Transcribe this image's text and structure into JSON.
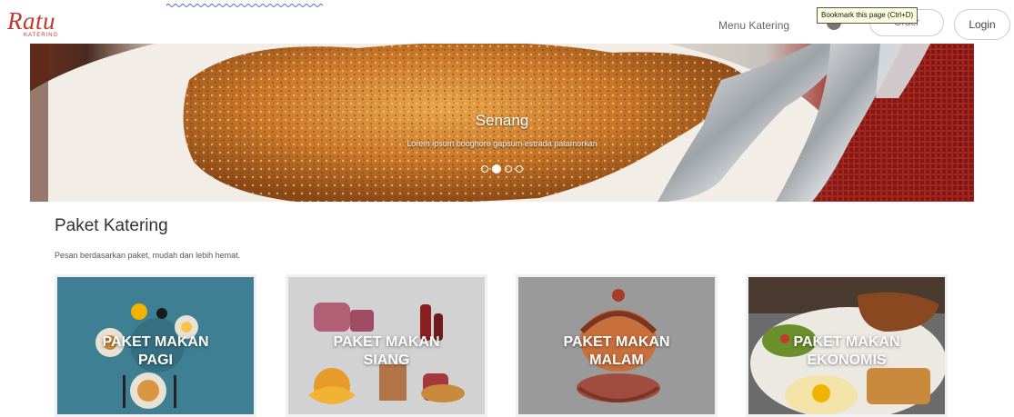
{
  "logo": {
    "text": "Ratu",
    "tagline": "KATERING"
  },
  "nav": {
    "menu_link": "Menu Katering",
    "order_button": "Order",
    "login_button": "Login",
    "bookmark_tooltip": "Bookmark this page (Ctrl+D)"
  },
  "hero": {
    "slide_title": "Senang",
    "slide_description": "Lorem ipsum booghore gapsum estrada patamorkan",
    "slide_count": 4,
    "active_slide": 2
  },
  "section": {
    "title": "Paket Katering",
    "subtitle": "Pesan berdasarkan paket, mudah dan lebih hemat."
  },
  "packages": [
    {
      "line1": "PAKET MAKAN",
      "line2": "PAGI",
      "bg": "#3f7f93"
    },
    {
      "line1": "PAKET MAKAN",
      "line2": "SIANG",
      "bg": "#d2d2d2"
    },
    {
      "line1": "PAKET MAKAN",
      "line2": "MALAM",
      "bg": "#9a9a9a"
    },
    {
      "line1": "PAKET MAKAN",
      "line2": "EKONOMIS",
      "bg": "#6b6b6b"
    }
  ],
  "colors": {
    "brand": "#c0392b"
  },
  "icons": [
    "user-icon",
    "bell-icon"
  ]
}
